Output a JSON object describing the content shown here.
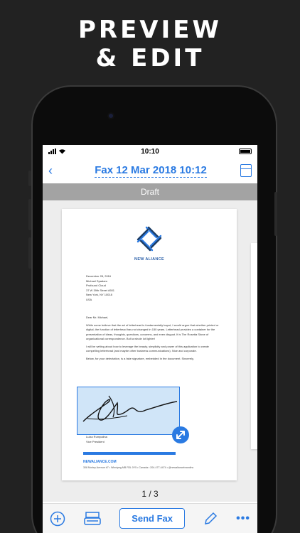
{
  "headline": [
    "PREVIEW",
    "& EDIT"
  ],
  "status": {
    "time": "10:10"
  },
  "nav": {
    "title": "Fax 12 Mar 2018 10:12",
    "back_icon": "chevron-left-icon",
    "pages_icon": "pages-icon"
  },
  "draft_label": "Draft",
  "letter": {
    "company": "NEW ALIANCE",
    "address_lines": [
      "December 28, 2016",
      "Michael Spadaro",
      "Profound Cloud",
      "37 W 39th Street #501",
      "New York, NY 10018",
      "USA"
    ],
    "greeting": "Dear Mr. Michael,",
    "paragraphs": [
      "While some believe that the art of letterhead is fundamentally kaput, I would argue that whether printed or digital, the function of letterhead has not changed in 150 years. Letterhead provides a container for the presentation of ideas, thoughts, questions, concerns, and even disgust. It is The Rosetta Stone of organizational correspondence. Bolt a whole lot lighter!",
      "I will be writing about how to leverage the beauty, simplicity and power of this application to create compelling letterhead (and maybe other business communications). Nice and corporate.",
      "Below, for your delectation, is a fake signature, embedded in the document. Sincerely,"
    ],
    "signer_name": "Luiza Rumpalina",
    "signer_title": "Vice President",
    "footer_link": "NEWALIANCE.COM",
    "footer_address": "308 Morley Avenue #7  •  Winnipeg MB R3L 0Y5  •  Canada  •  204-477-4474  •  @newaliancebrandinc"
  },
  "pager": "1 / 3",
  "toolbar": {
    "send_label": "Send Fax",
    "more_label": "•••"
  }
}
